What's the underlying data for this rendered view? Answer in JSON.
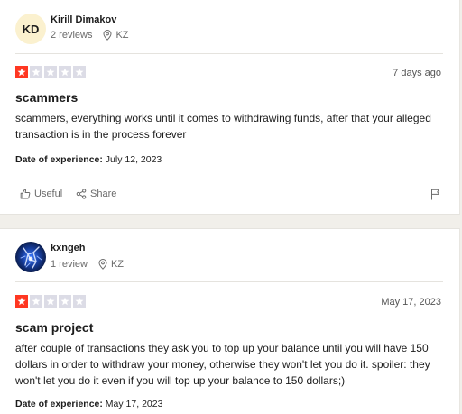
{
  "reviews": [
    {
      "avatar_initials": "KD",
      "author": "Kirill Dimakov",
      "review_count": "2 reviews",
      "country": "KZ",
      "rating": 1,
      "posted": "7 days ago",
      "title": "scammers",
      "body": "scammers, everything works until it comes to withdrawing funds, after that your alleged transaction is in the process forever",
      "experience_label": "Date of experience:",
      "experience_date": "July 12, 2023",
      "useful_label": "Useful",
      "share_label": "Share"
    },
    {
      "author": "kxngeh",
      "review_count": "1 review",
      "country": "KZ",
      "rating": 1,
      "posted": "May 17, 2023",
      "title": "scam project",
      "body": "after couple of transactions they ask you to top up your balance until you will have 150 dollars in order to withdraw your money, otherwise they won't let you do it. spoiler: they won't let you do it even if you will top up your balance to 150 dollars;)",
      "experience_label": "Date of experience:",
      "experience_date": "May 17, 2023"
    }
  ],
  "colors": {
    "star_active": "#ff3722",
    "star_inactive": "#dcdce6",
    "avatar_bg": "#fbf1cf",
    "page_bg": "#f1efea"
  },
  "icons": {
    "location": "location-pin-icon",
    "star": "star-icon",
    "useful": "thumbs-up-icon",
    "share": "share-icon",
    "report": "flag-icon"
  }
}
